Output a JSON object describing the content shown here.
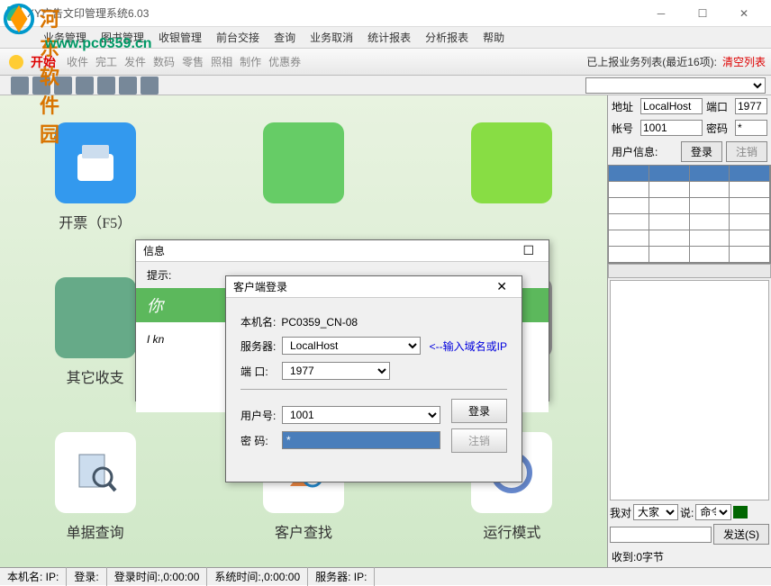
{
  "window": {
    "title": "XY广告文印管理系统6.03"
  },
  "watermark": {
    "logo": "河东软件园",
    "url": "www.pc0359.cn"
  },
  "menu": [
    "业务管理",
    "图书管理",
    "收银管理",
    "前台交接",
    "查询",
    "业务取消",
    "统计报表",
    "分析报表",
    "帮助"
  ],
  "toolbar": {
    "start": "开始",
    "labels": [
      "收件",
      "完工",
      "发件",
      "数码",
      "零售",
      "照相",
      "制作",
      "优惠券"
    ],
    "report_label": "已上报业务列表(最近16项):",
    "clear": "清空列表"
  },
  "icons": [
    {
      "label": "开票（F5）",
      "color": "#3399ee"
    },
    {
      "label": "",
      "color": "#66cc66"
    },
    {
      "label": "",
      "color": "#88dd44"
    },
    {
      "label": "其它收支",
      "color": "#66aa88"
    },
    {
      "label": "",
      "color": "#ffaa44"
    },
    {
      "label": "",
      "color": "#999"
    },
    {
      "label": "单据查询",
      "color": "#88aacc"
    },
    {
      "label": "客户查找",
      "color": "#ee9944"
    },
    {
      "label": "运行模式",
      "color": "#6688dd"
    }
  ],
  "side": {
    "addr_label": "地址",
    "addr": "LocalHost",
    "port_label": "端口",
    "port": "1977",
    "acct_label": "帐号",
    "acct": "1001",
    "pwd_label": "密码",
    "pwd": "*",
    "user_info": "用户信息:",
    "login": "登录",
    "logout": "注销",
    "me_to": "我对",
    "all": "大家",
    "say": "说:",
    "cmd": "命令",
    "send": "发送(S)",
    "recv": "收到:0字节"
  },
  "info_dialog": {
    "title": "信息",
    "hint": "提示:",
    "banner": "你",
    "body": "I kn"
  },
  "login_dialog": {
    "title": "客户端登录",
    "machine_label": "本机名:",
    "machine": "PC0359_CN-08",
    "server_label": "服务器:",
    "server": "LocalHost",
    "server_hint": "<--输入域名或IP",
    "port_label": "端 口:",
    "port": "1977",
    "user_label": "用户号:",
    "user": "1001",
    "pwd_label": "密 码:",
    "pwd": "*",
    "login": "登录",
    "logout": "注销"
  },
  "status": {
    "machine": "本机名: IP:",
    "login": "登录:",
    "login_time": "登录时间:,0:00:00",
    "sys_time": "系统时间:,0:00:00",
    "server": "服务器: IP:"
  }
}
